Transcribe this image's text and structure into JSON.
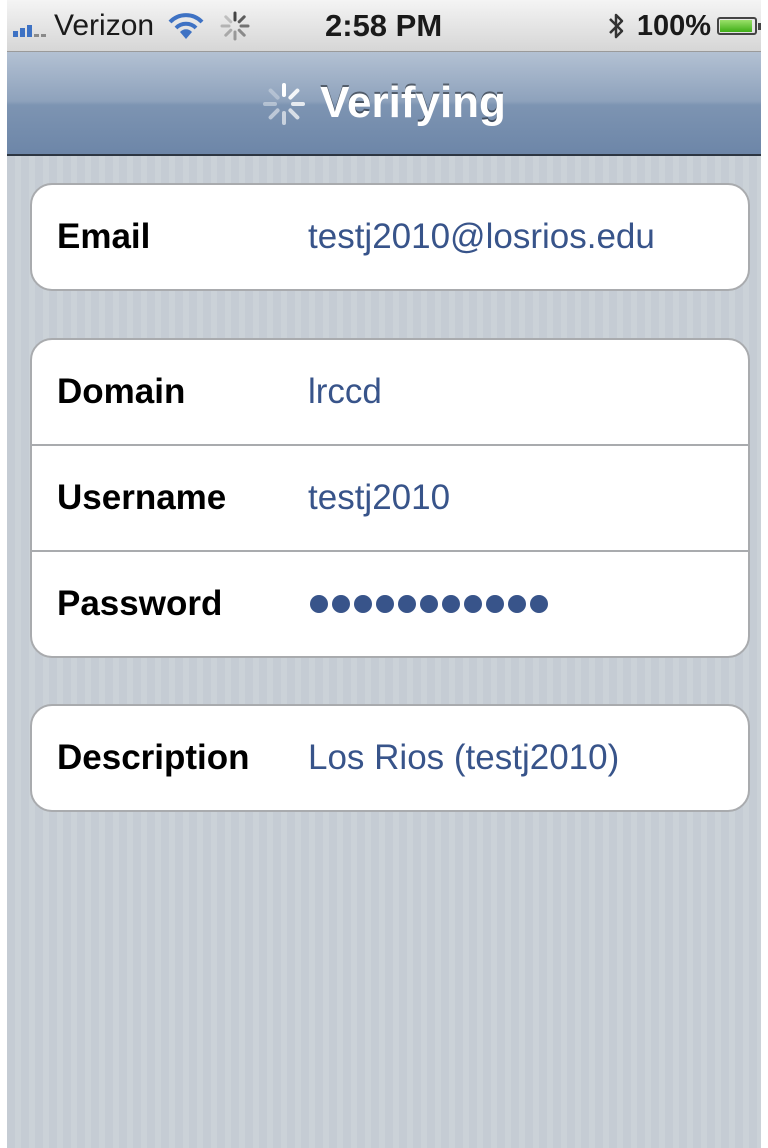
{
  "status_bar": {
    "carrier": "Verizon",
    "time": "2:58 PM",
    "battery_percent": "100%",
    "signal_bars": 3,
    "battery_level": 1.0,
    "icons": [
      "signal-icon",
      "wifi-icon",
      "activity-spinner-icon",
      "bluetooth-icon",
      "battery-icon"
    ]
  },
  "navbar": {
    "title": "Verifying",
    "icon": "activity-spinner-icon"
  },
  "account": {
    "email": {
      "label": "Email",
      "value": "testj2010@losrios.edu"
    },
    "domain": {
      "label": "Domain",
      "value": "lrccd"
    },
    "username": {
      "label": "Username",
      "value": "testj2010"
    },
    "password": {
      "label": "Password",
      "masked_length": 11
    },
    "description": {
      "label": "Description",
      "value": "Los Rios (testj2010)"
    }
  },
  "colors": {
    "value_text": "#38548a",
    "navbar": "#7d94b2",
    "background_stripes": "#c5ccd4"
  }
}
